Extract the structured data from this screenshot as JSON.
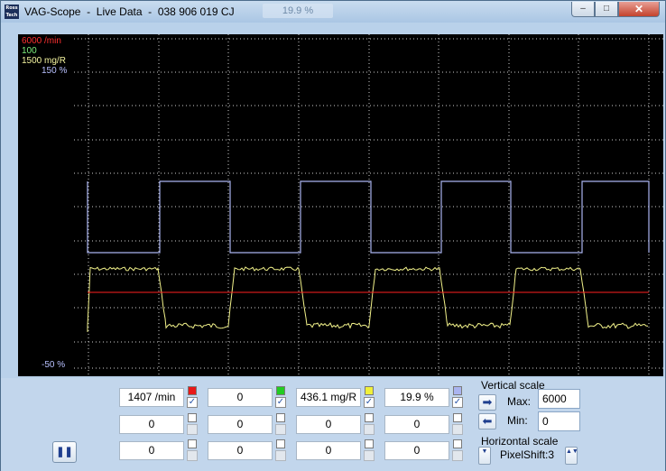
{
  "window": {
    "title": "VAG-Scope  -  Live Data  -  038 906 019 CJ",
    "overlay_value": "19.9 %",
    "buttons": {
      "minimize": "–",
      "maximize": "□",
      "close": "✕"
    },
    "icon_text": "Ross Tech"
  },
  "scale_labels": {
    "ch1_max": "6000 /min",
    "ch2_max": "100",
    "ch3_max": "1500 mg/R",
    "ch4_max": "150 %",
    "ch4_min": "-50 %"
  },
  "colors": {
    "ch1": "#ff2020",
    "ch2": "#22cc22",
    "ch3": "#f2f28a",
    "ch4": "#aab4f0",
    "ch1_label": "#ff3030",
    "ch2_label": "#7df07d",
    "ch3_label": "#f5f5a0",
    "ch4_label": "#b8c0ff"
  },
  "channels": {
    "row1": [
      {
        "value": "1407 /min",
        "swatch": "red"
      },
      {
        "value": "0",
        "swatch": "green"
      },
      {
        "value": "436.1 mg/R",
        "swatch": "yellow"
      },
      {
        "value": "19.9 %",
        "swatch": "lavender"
      }
    ],
    "row2": [
      "0",
      "0",
      "0",
      "0"
    ],
    "row3": [
      "0",
      "0",
      "0",
      "0"
    ]
  },
  "vertical_scale": {
    "label": "Vertical scale",
    "max_label": "Max:",
    "max_value": "6000",
    "min_label": "Min:",
    "min_value": "0"
  },
  "horizontal_scale": {
    "label": "Horizontal scale",
    "value": "PixelShift:3"
  },
  "icons": {
    "pause": "❚❚",
    "arrow_right": "➡",
    "arrow_left": "⬅",
    "spin_down": "▼",
    "spin_updown": "▲▼",
    "check": "✓"
  }
}
